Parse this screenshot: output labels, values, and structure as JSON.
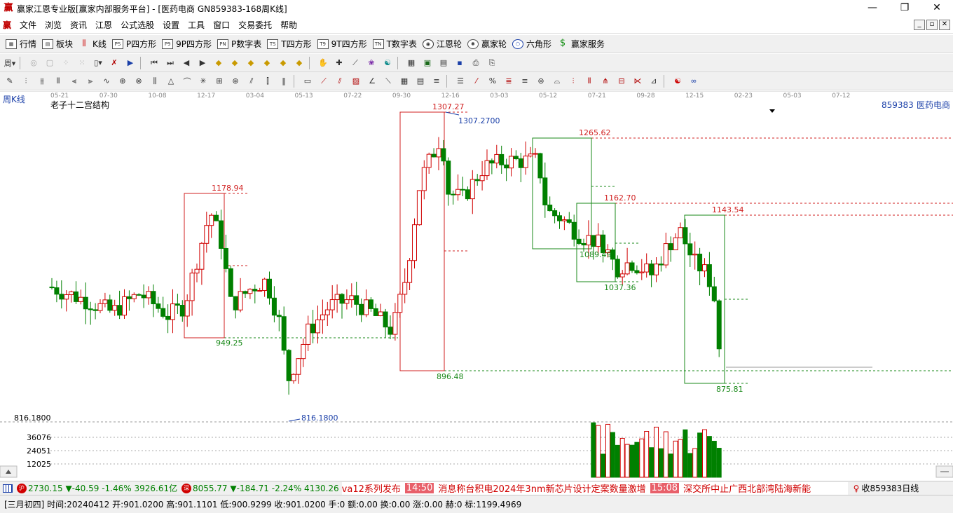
{
  "window": {
    "title": "赢家江恩专业版[赢家内部服务平台] - [医药电商  GN859383-168周K线]",
    "app_icon": "赢",
    "buttons": {
      "minimize": "—",
      "maximize": "❐",
      "close": "✕"
    }
  },
  "menu": {
    "logo": "赢",
    "items": [
      "文件",
      "浏览",
      "资讯",
      "江恩",
      "公式选股",
      "设置",
      "工具",
      "窗口",
      "交易委托",
      "帮助"
    ],
    "mdi_buttons": [
      "_",
      "▫",
      "✕"
    ]
  },
  "toolbar1": {
    "items": [
      {
        "icon": "table-icon",
        "label": "行情"
      },
      {
        "icon": "block-icon",
        "label": "板块"
      },
      {
        "icon": "kline-icon",
        "label": "K线"
      },
      {
        "icon": "ps-icon",
        "label": "P四方形",
        "code": "PS"
      },
      {
        "icon": "p9-icon",
        "label": "9P四方形",
        "code": "P9"
      },
      {
        "icon": "pn-icon",
        "label": "P数字表",
        "code": "PN"
      },
      {
        "icon": "ts-icon",
        "label": "T四方形",
        "code": "TS"
      },
      {
        "icon": "t9-icon",
        "label": "9T四方形",
        "code": "T9"
      },
      {
        "icon": "tn-icon",
        "label": "T数字表",
        "code": "TN"
      },
      {
        "icon": "wheel-icon",
        "label": "江恩轮"
      },
      {
        "icon": "win-wheel-icon",
        "label": "赢家轮"
      },
      {
        "icon": "hexagon-icon",
        "label": "六角形"
      },
      {
        "icon": "dollar-icon",
        "label": "赢家服务"
      }
    ]
  },
  "chart": {
    "period_label": "周K线",
    "indicator_name": "老子十二宫结构",
    "code_label": "859383",
    "name_label": "医药电商",
    "date_ticks": [
      "05-21",
      "07-30",
      "10-08",
      "12-17",
      "03-04",
      "05-13",
      "07-22",
      "09-30",
      "12-16",
      "03-03",
      "05-12",
      "07-21",
      "09-28",
      "12-15",
      "02-23",
      "05-03",
      "07-12"
    ],
    "price_labels": {
      "p1307_27": "1307.27",
      "p1307_2700": "1307.2700",
      "p1265_62": "1265.62",
      "p1178_94": "1178.94",
      "p1162_70": "1162.70",
      "p1143_54": "1143.54",
      "p1089_49": "1089.49",
      "p1037_36": "1037.36",
      "p949_25": "949.25",
      "p896_48": "896.48",
      "p875_81": "875.81",
      "p816_1800": "816.1800",
      "axis_816": "816.1800"
    },
    "volume_axis": [
      "36076",
      "24051",
      "12025"
    ],
    "colors": {
      "up": "#d00000",
      "down": "#008000",
      "box_red": "#d02020",
      "box_green": "#1a8a1a",
      "blue": "#1a3fa8"
    }
  },
  "ticker": {
    "sh_value": "2730.15",
    "sh_change": "▼-40.59",
    "sh_pct": "-1.46%",
    "sh_amount": "3926.61亿",
    "sz_value": "8055.77",
    "sz_change": "▼-184.71",
    "sz_pct": "-2.24%",
    "sz_amount": "4130.26",
    "news_lead": "va12系列发布",
    "news1_time": "14:50",
    "news1_text": "消息称台积电2024年3nm新芯片设计定案数量激增",
    "news2_time": "15:08",
    "news2_text": "深交所中止广西北部湾陆海新能",
    "right_label": "收859383日线"
  },
  "status": {
    "text": "[三月初四] 时间:20240412 开:901.0200 高:901.1101 低:900.9299 收:901.0200 手:0 额:0.00 换:0.00 涨:0.00 赫:0 标:1199.4969"
  }
}
